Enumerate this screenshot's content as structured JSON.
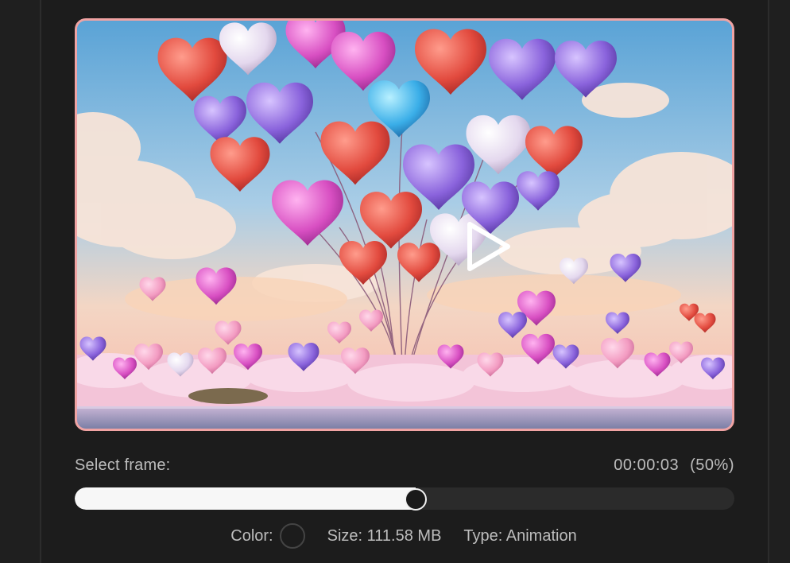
{
  "preview": {
    "description_icon": "play-icon",
    "border_color": "#f0a3a3"
  },
  "frame": {
    "label": "Select frame:",
    "timecode": "00:00:03",
    "percent_text": "(50%)",
    "progress": 0.5
  },
  "meta": {
    "color_label": "Color:",
    "size_text": "Size: 111.58 MB",
    "type_text": "Type: Animation"
  }
}
